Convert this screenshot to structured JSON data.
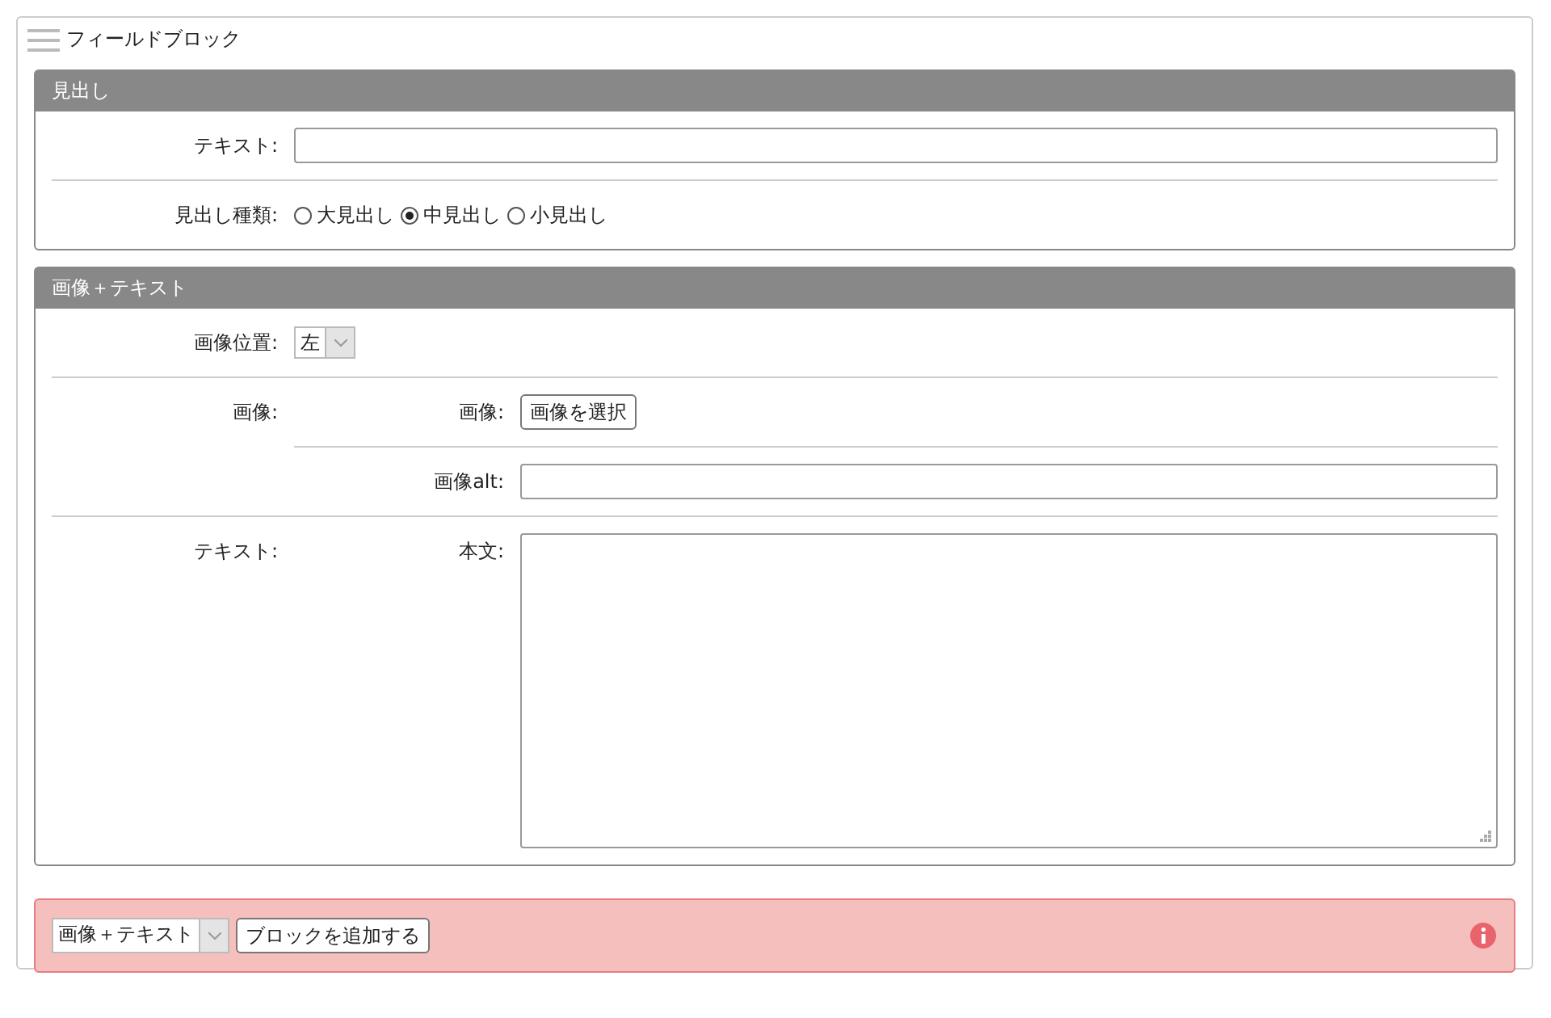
{
  "title": "フィールドブロック",
  "blocks": [
    {
      "title": "見出し",
      "fields": [
        {
          "kind": "text",
          "label": "テキスト:"
        },
        {
          "kind": "radio",
          "label": "見出し種類:",
          "options": [
            {
              "label": "大見出し",
              "selected": false
            },
            {
              "label": "中見出し",
              "selected": true
            },
            {
              "label": "小見出し",
              "selected": false
            }
          ]
        }
      ]
    },
    {
      "title": "画像＋テキスト",
      "fields": [
        {
          "kind": "select",
          "label": "画像位置:",
          "value": "左"
        },
        {
          "kind": "group",
          "label": "画像:",
          "children": [
            {
              "kind": "file",
              "label": "画像:",
              "button": "画像を選択"
            },
            {
              "kind": "text",
              "label": "画像alt:"
            }
          ]
        },
        {
          "kind": "group",
          "label": "テキスト:",
          "children": [
            {
              "kind": "textarea",
              "label": "本文:"
            }
          ]
        }
      ]
    }
  ],
  "add_bar": {
    "select_value": "画像＋テキスト",
    "button": "ブロックを追加する"
  }
}
